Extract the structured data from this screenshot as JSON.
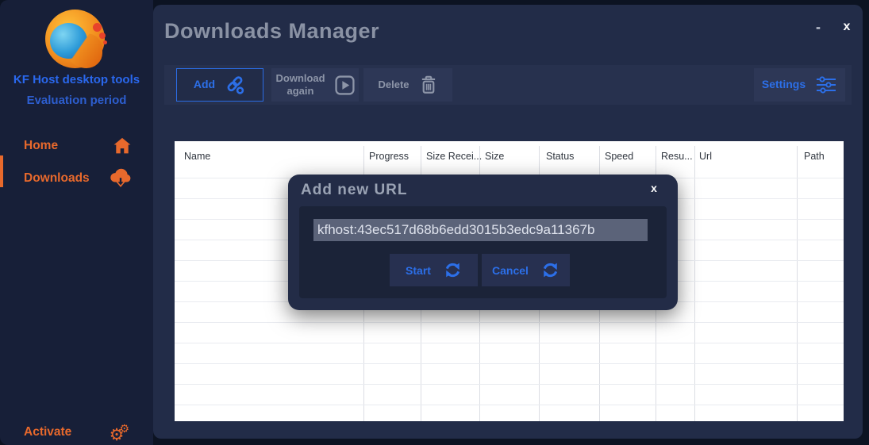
{
  "window": {
    "minimize_label": "-",
    "close_label": "x"
  },
  "sidebar": {
    "brand": "KF Host desktop tools",
    "license": "Evaluation period",
    "items": [
      {
        "label": "Home",
        "icon": "home-icon",
        "active": false
      },
      {
        "label": "Downloads",
        "icon": "cloud-download-icon",
        "active": true
      }
    ],
    "footer_item": {
      "label": "Activate",
      "icon": "gears-icon"
    }
  },
  "header": {
    "title": "Downloads Manager"
  },
  "toolbar": {
    "add_label": "Add",
    "download_again_label": "Download again",
    "delete_label": "Delete",
    "settings_label": "Settings"
  },
  "table": {
    "columns": [
      "Name",
      "Progress",
      "Size Recei...",
      "Size",
      "Status",
      "Speed",
      "Resu...",
      "Url",
      "Path"
    ],
    "rows": []
  },
  "modal": {
    "title": "Add new URL",
    "close_label": "x",
    "url_value": "kfhost:43ec517d68b6edd3015b3edc9a11367b",
    "start_label": "Start",
    "cancel_label": "Cancel"
  },
  "colors": {
    "accent_blue": "#2c6fe8",
    "brand_blue": "#2a68ee",
    "accent_orange": "#e8692c",
    "sidebar_bg": "#171f38",
    "panel_bg": "#222c48",
    "toolbar_bg": "#27314e",
    "button_bg": "#2d3756",
    "modal_bg": "#232c47",
    "modal_inner_bg": "#1b2338",
    "selection_bg": "#5b6379",
    "table_bg": "#ffffff"
  }
}
